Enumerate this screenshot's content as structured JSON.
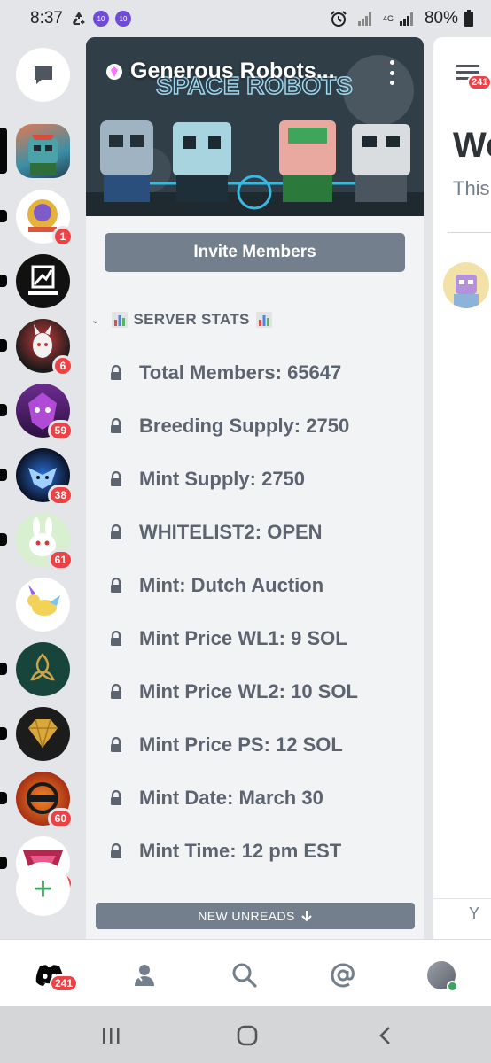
{
  "status_bar": {
    "time": "8:37",
    "battery": "80%",
    "network_4g": "4G"
  },
  "server_rail": {
    "badges": [
      "1",
      "6",
      "59",
      "38",
      "61",
      "60",
      "16"
    ]
  },
  "panel": {
    "server_name": "Generous Robots...",
    "banner_text": "SPACE ROBOTS",
    "invite_label": "Invite Members",
    "category": "SERVER STATS",
    "channels": [
      "Total Members: 65647",
      "Breeding Supply: 2750",
      "Mint Supply: 2750",
      "WHITELIST2: OPEN",
      "Mint: Dutch Auction",
      "Mint Price WL1: 9 SOL",
      "Mint Price WL2: 10 SOL",
      "Mint Price PS: 12 SOL",
      "Mint Date: March 30",
      "Mint Time: 12 pm EST"
    ],
    "new_unreads": "NEW UNREADS"
  },
  "peek": {
    "badge": "241",
    "heading": "We",
    "subtext": "This",
    "footer_text": "Y"
  },
  "tabbar": {
    "home_badge": "241"
  },
  "colors": {
    "accent_red": "#ed4245",
    "online_green": "#3ba55d",
    "button_gray": "#747f8d",
    "channel_text": "#5c6470"
  }
}
